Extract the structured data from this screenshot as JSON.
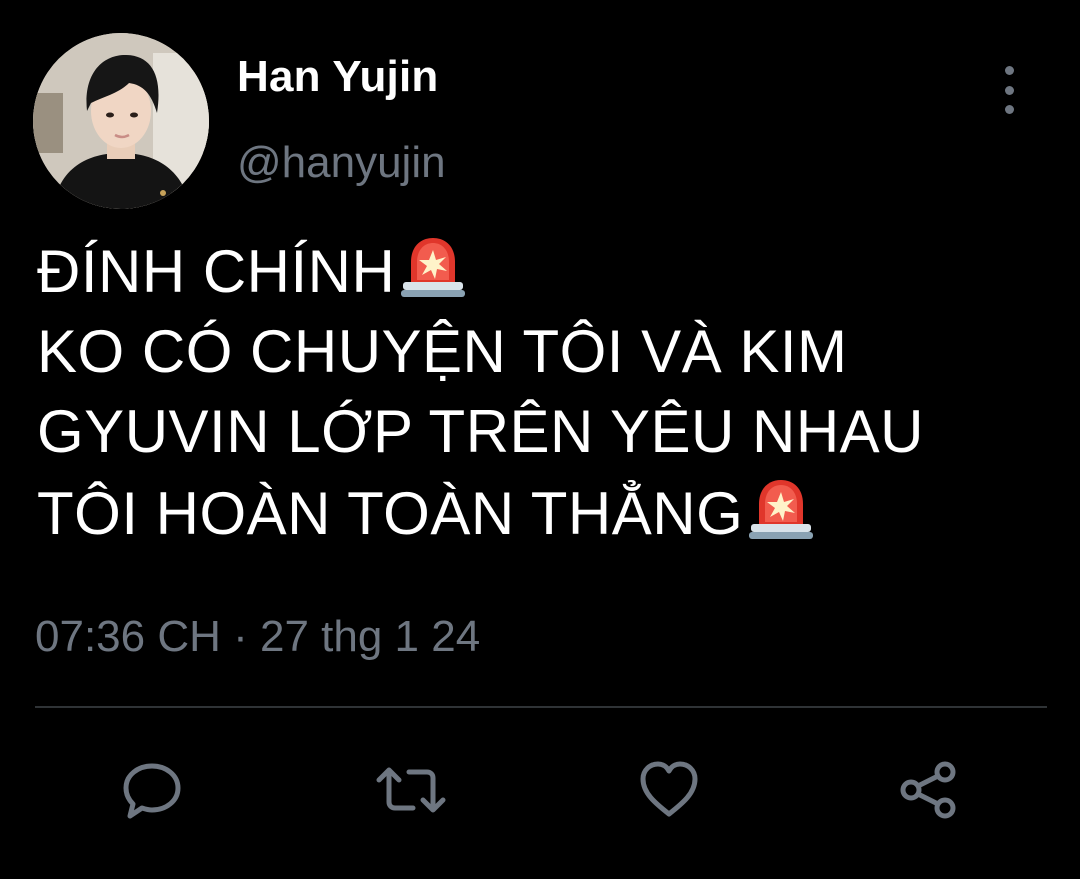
{
  "tweet": {
    "author": {
      "display_name": "Han Yujin",
      "handle": "@hanyujin"
    },
    "text_lines": [
      "ĐÍNH CHÍNH",
      "KO CÓ CHUYỆN TÔI VÀ KIM",
      "GYUVIN LỚP TRÊN YÊU NHAU",
      "TÔI HOÀN TOÀN THẲNG"
    ],
    "emoji": "rotating-light",
    "timestamp": "07:36 CH · 27 thg 1 24"
  },
  "actions": [
    {
      "name": "reply",
      "icon": "comment-icon"
    },
    {
      "name": "retweet",
      "icon": "retweet-icon"
    },
    {
      "name": "like",
      "icon": "heart-icon"
    },
    {
      "name": "share",
      "icon": "share-icon"
    }
  ],
  "colors": {
    "background": "#000000",
    "text_primary": "#ffffff",
    "text_secondary": "#6e7681",
    "divider": "#2f3336",
    "icon": "#6e7681"
  }
}
